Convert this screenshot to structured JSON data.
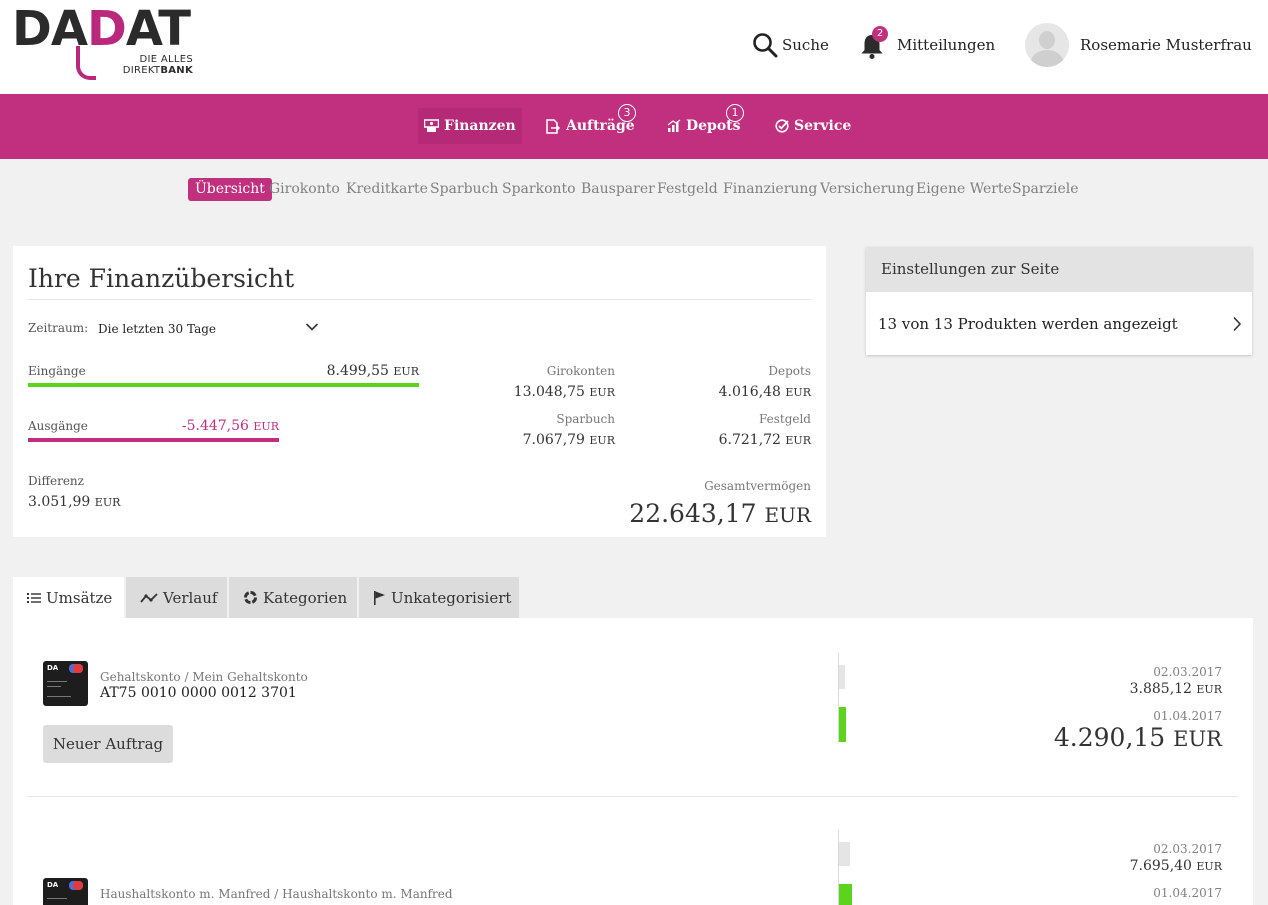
{
  "brand": {
    "logo_main_a": "DA",
    "logo_main_p": "D",
    "logo_main_b": "AT",
    "logo_line1": "DIE ALLES",
    "logo_line2a": "DIREKT",
    "logo_line2b": "BANK",
    "accent": "#c0307f"
  },
  "header": {
    "search_label": "Suche",
    "messages_label": "Mitteilungen",
    "messages_count": "2",
    "user_name": "Rosemarie Musterfrau"
  },
  "main_nav": [
    {
      "label": "Finanzen",
      "icon": "finance-icon",
      "badge": ""
    },
    {
      "label": "Aufträge",
      "icon": "orders-icon",
      "badge": "3"
    },
    {
      "label": "Depots",
      "icon": "depot-chart-icon",
      "badge": "1"
    },
    {
      "label": "Service",
      "icon": "service-check-icon",
      "badge": ""
    }
  ],
  "sub_nav": [
    "Übersicht",
    "Girokonto",
    "Kreditkarte",
    "Sparbuch",
    "Sparkonto",
    "Bausparer",
    "Festgeld",
    "Finanzierung",
    "Versicherung",
    "Eigene Werte",
    "Sparziele"
  ],
  "overview": {
    "title": "Ihre Finanzübersicht",
    "period_label": "Zeitraum:",
    "period_value": "Die letzten 30 Tage",
    "income_label": "Eingänge",
    "income_value": "8.499,55",
    "expenses_label": "Ausgänge",
    "expenses_value": "-5.447,56",
    "difference_label": "Differenz",
    "difference_value": "3.051,99",
    "currency": "EUR",
    "girokonten_label": "Girokonten",
    "girokonten_value": "13.048,75",
    "depots_label": "Depots",
    "depots_value": "4.016,48",
    "sparbuch_label": "Sparbuch",
    "sparbuch_value": "7.067,79",
    "festgeld_label": "Festgeld",
    "festgeld_value": "6.721,72",
    "total_label": "Gesamtvermögen",
    "total_value": "22.643,17",
    "income_color": "#5cd41e",
    "expense_color": "#c0307f"
  },
  "settings": {
    "title": "Einstellungen zur Seite",
    "products_text": "13 von 13 Produkten werden angezeigt"
  },
  "tabs": [
    {
      "label": "Umsätze",
      "icon": "list-icon"
    },
    {
      "label": "Verlauf",
      "icon": "trend-line-icon"
    },
    {
      "label": "Kategorien",
      "icon": "donut-icon"
    },
    {
      "label": "Unkategorisiert",
      "icon": "flag-icon"
    }
  ],
  "accounts": [
    {
      "name": "Gehaltskonto / Mein Gehaltskonto",
      "iban": "AT75 0010 0000 0012 3701",
      "button": "Neuer Auftrag",
      "date1": "02.03.2017",
      "balance1": "3.885,12",
      "date2": "01.04.2017",
      "balance2": "4.290,15"
    },
    {
      "name": "Haushaltskonto m. Manfred / Haushaltskonto m. Manfred",
      "date1": "02.03.2017",
      "balance1": "7.695,40",
      "date2": "01.04.2017"
    }
  ]
}
